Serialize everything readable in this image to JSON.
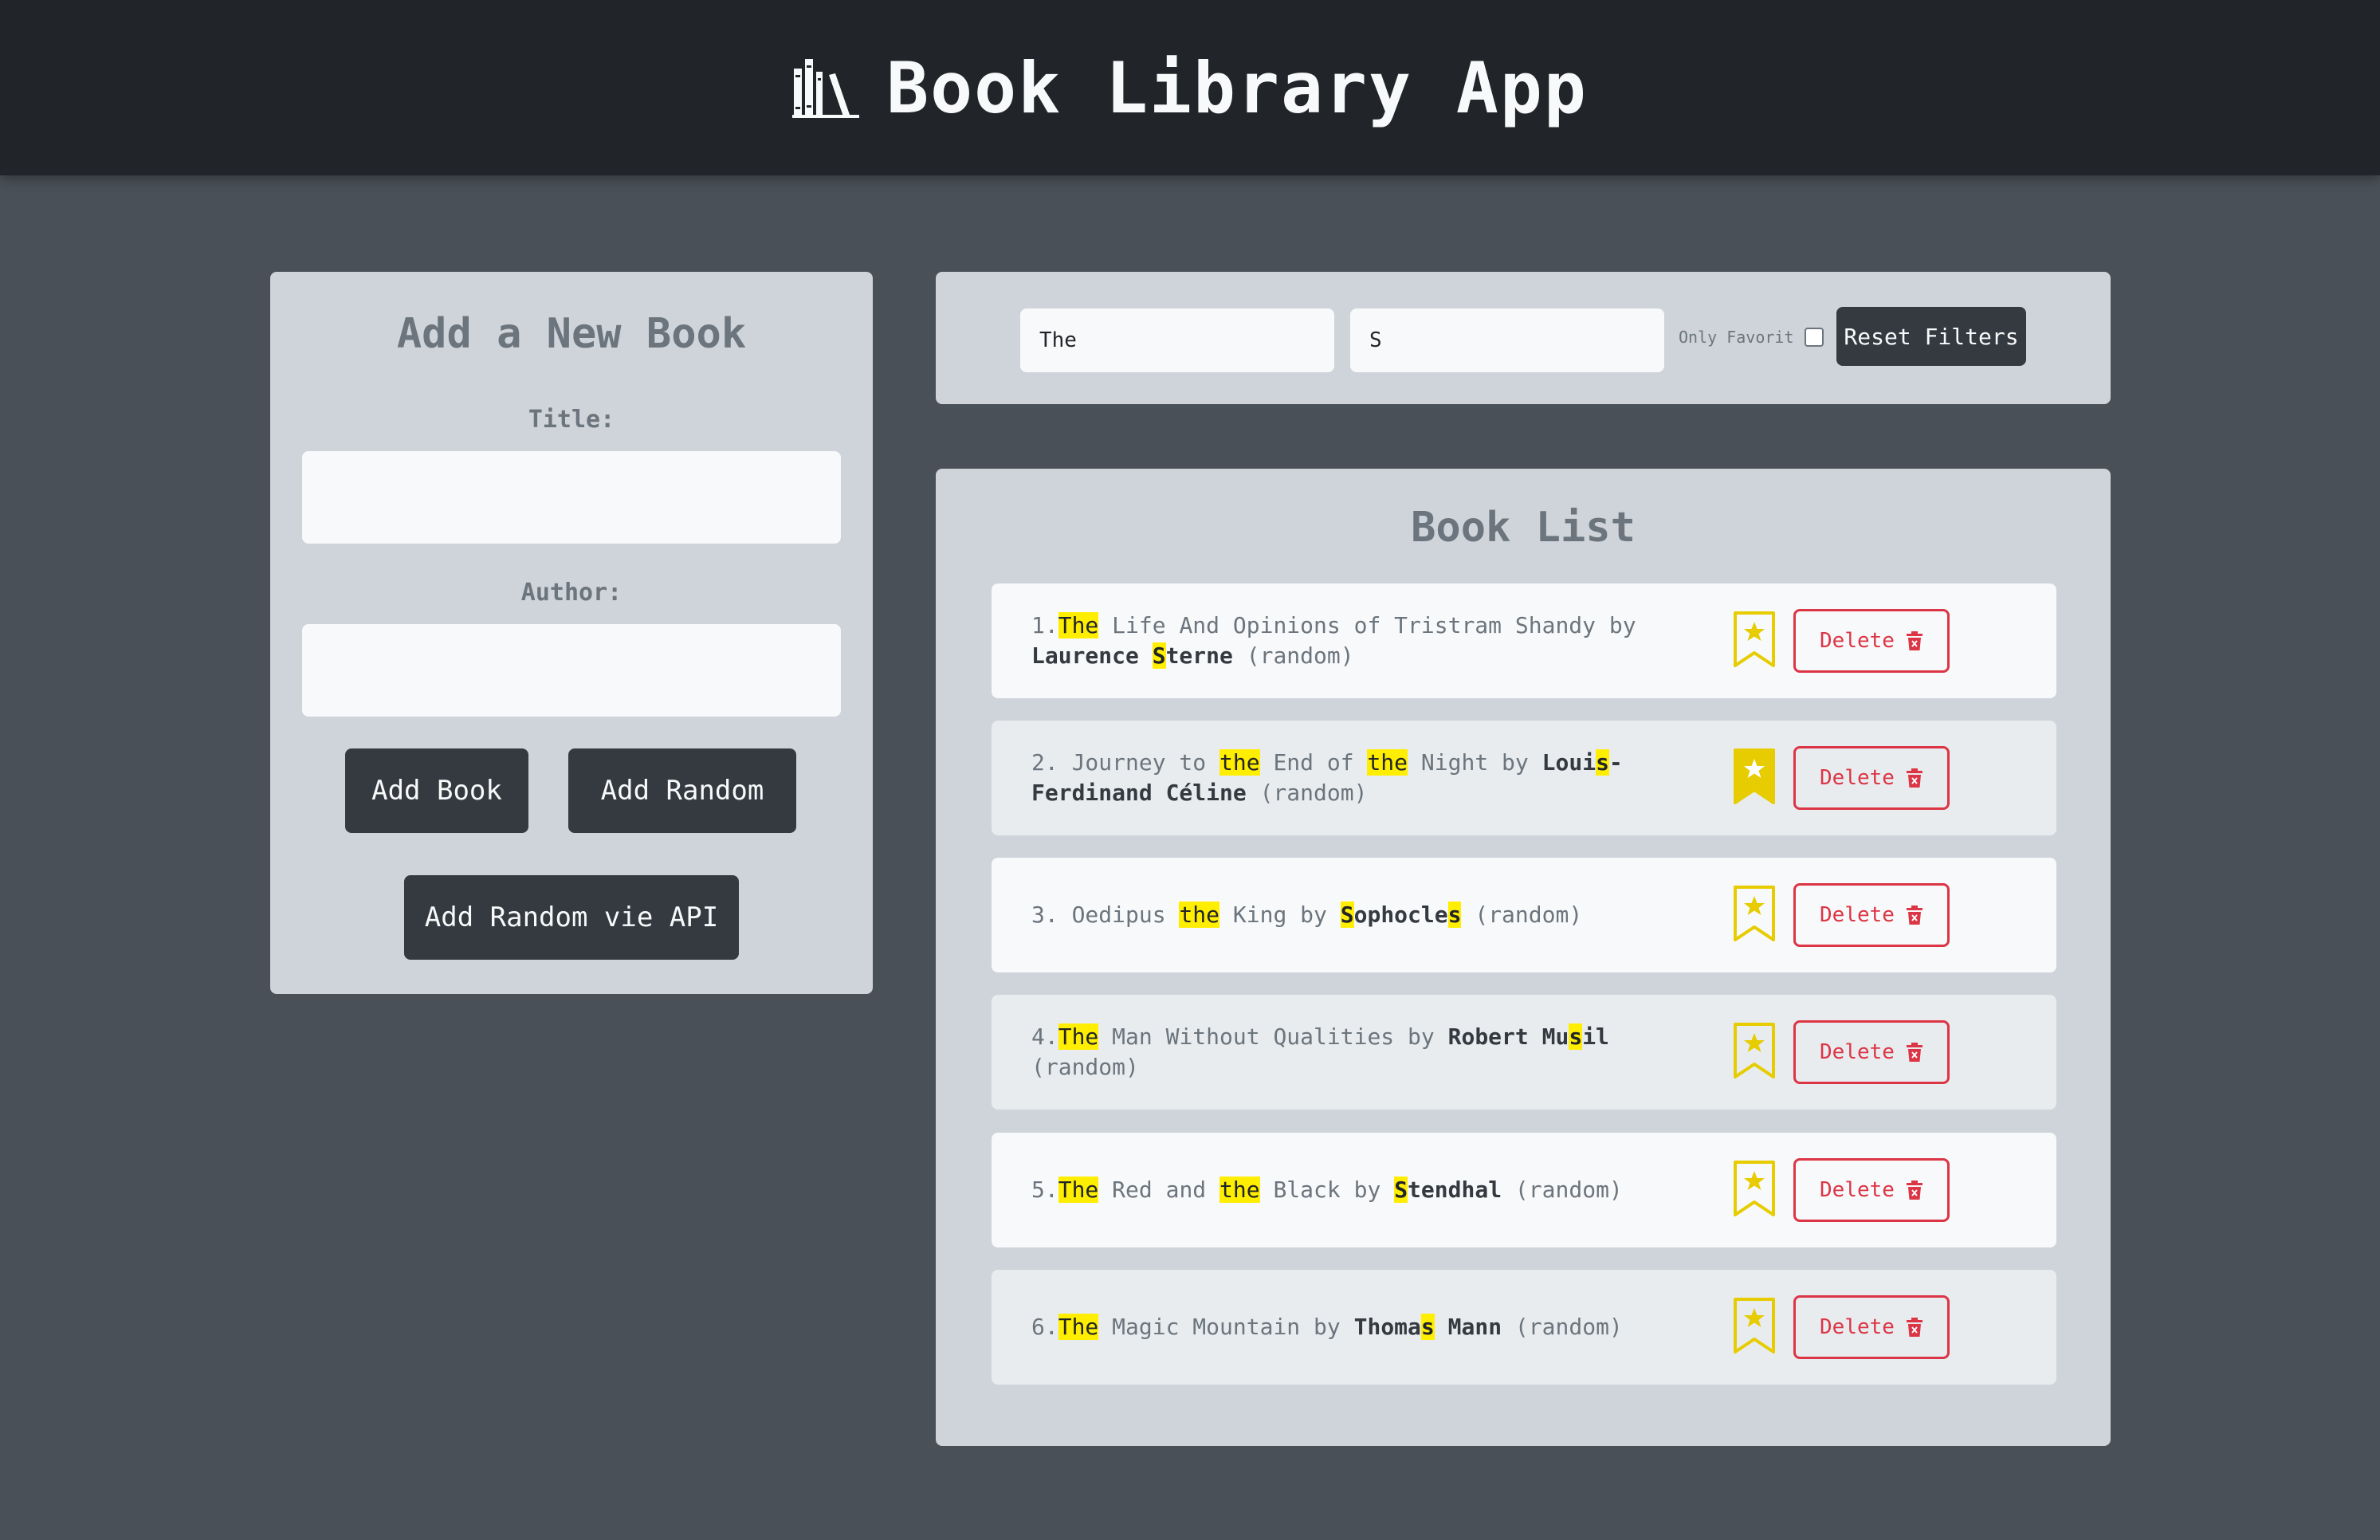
{
  "header": {
    "title": "Book Library App",
    "icon": "books-icon"
  },
  "add_form": {
    "title": "Add a New Book",
    "title_label": "Title:",
    "title_value": "",
    "author_label": "Author:",
    "author_value": "",
    "add_book_button": "Add Book",
    "add_random_button": "Add Random",
    "add_random_api_button": "Add Random vie API"
  },
  "filters": {
    "title_filter_value": "The",
    "author_filter_value": "S",
    "only_favorite_label": "Only Favorit",
    "only_favorite_checked": false,
    "reset_button": "Reset Filters"
  },
  "book_list": {
    "title": "Book List",
    "delete_label": "Delete",
    "highlight_color": "#ffee00",
    "favorite_color": "#e6cc00",
    "delete_color": "#dc3545",
    "items": [
      {
        "index": "1.",
        "title_parts": [
          {
            "t": "The",
            "h": true
          },
          {
            "t": " Life And Opinions of Tristram Shandy",
            "h": false
          }
        ],
        "by": " by ",
        "author_parts": [
          {
            "t": "Laurence ",
            "h": false
          },
          {
            "t": "S",
            "h": true
          },
          {
            "t": "terne",
            "h": false
          }
        ],
        "source": " (random)",
        "favorite": false
      },
      {
        "index": "2.",
        "title_parts": [
          {
            "t": " Journey to ",
            "h": false
          },
          {
            "t": "the",
            "h": true
          },
          {
            "t": " End of ",
            "h": false
          },
          {
            "t": "the",
            "h": true
          },
          {
            "t": " Night",
            "h": false
          }
        ],
        "by": " by ",
        "author_parts": [
          {
            "t": "Loui",
            "h": false
          },
          {
            "t": "s",
            "h": true
          },
          {
            "t": "-Ferdinand Céline",
            "h": false
          }
        ],
        "source": " (random)",
        "favorite": true
      },
      {
        "index": "3.",
        "title_parts": [
          {
            "t": " Oedipus ",
            "h": false
          },
          {
            "t": "the",
            "h": true
          },
          {
            "t": " King",
            "h": false
          }
        ],
        "by": " by ",
        "author_parts": [
          {
            "t": "S",
            "h": true
          },
          {
            "t": "ophocle",
            "h": false
          },
          {
            "t": "s",
            "h": true
          }
        ],
        "source": " (random)",
        "favorite": false
      },
      {
        "index": "4.",
        "title_parts": [
          {
            "t": "The",
            "h": true
          },
          {
            "t": " Man Without Qualities",
            "h": false
          }
        ],
        "by": " by ",
        "author_parts": [
          {
            "t": "Robert Mu",
            "h": false
          },
          {
            "t": "s",
            "h": true
          },
          {
            "t": "il",
            "h": false
          }
        ],
        "source": " (random)",
        "favorite": false
      },
      {
        "index": "5.",
        "title_parts": [
          {
            "t": "The",
            "h": true
          },
          {
            "t": " Red and ",
            "h": false
          },
          {
            "t": "the",
            "h": true
          },
          {
            "t": " Black",
            "h": false
          }
        ],
        "by": " by ",
        "author_parts": [
          {
            "t": "S",
            "h": true
          },
          {
            "t": "tendhal",
            "h": false
          }
        ],
        "source": " (random)",
        "favorite": false
      },
      {
        "index": "6.",
        "title_parts": [
          {
            "t": "The",
            "h": true
          },
          {
            "t": " Magic Mountain",
            "h": false
          }
        ],
        "by": " by ",
        "author_parts": [
          {
            "t": "Thoma",
            "h": false
          },
          {
            "t": "s",
            "h": true
          },
          {
            "t": " Mann",
            "h": false
          }
        ],
        "source": " (random)",
        "favorite": false
      }
    ]
  }
}
